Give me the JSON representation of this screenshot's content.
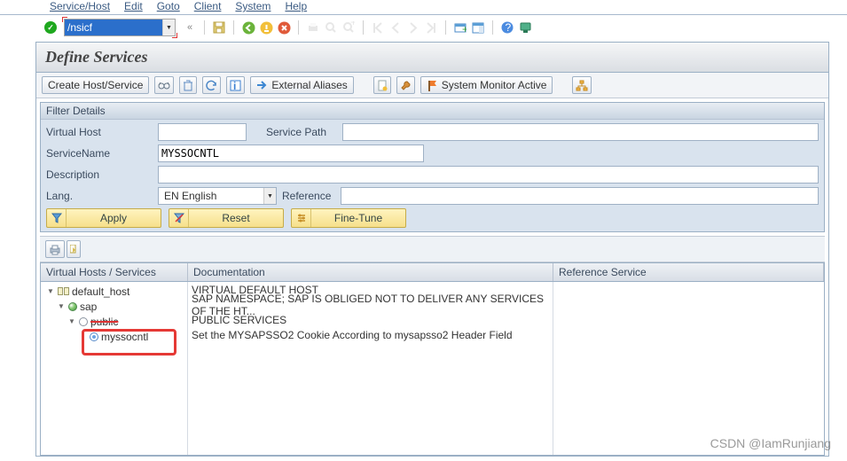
{
  "menu": {
    "m1": "Service/Host",
    "m2": "Edit",
    "m3": "Goto",
    "m4": "Client",
    "m5": "System",
    "m6": "Help"
  },
  "cmd": {
    "value": "/nsicf"
  },
  "page_title": "Define Services",
  "apptb": {
    "create": "Create Host/Service",
    "extal": "External Aliases",
    "sysmon": "System Monitor Active"
  },
  "filter": {
    "panel_title": "Filter Details",
    "vh_label": "Virtual Host",
    "vh_value": "",
    "sp_label": "Service Path",
    "sp_value": "",
    "sn_label": "ServiceName",
    "sn_value": "MYSSOCNTL",
    "desc_label": "Description",
    "desc_value": "",
    "lang_label": "Lang.",
    "lang_value": "EN English",
    "ref_label": "Reference",
    "ref_value": "",
    "apply": "Apply",
    "reset": "Reset",
    "fine": "Fine-Tune"
  },
  "grid": {
    "h1": "Virtual Hosts / Services",
    "h2": "Documentation",
    "h3": "Reference Service",
    "r1": {
      "name": "default_host",
      "doc": "VIRTUAL DEFAULT HOST"
    },
    "r2": {
      "name": "sap",
      "doc": "SAP NAMESPACE; SAP IS OBLIGED NOT TO DELIVER ANY SERVICES OF THE HT..."
    },
    "r3": {
      "name": "public",
      "doc": "PUBLIC SERVICES"
    },
    "r4": {
      "name": "myssocntl",
      "doc": "Set the MYSAPSSO2 Cookie According to mysapsso2 Header Field"
    }
  },
  "watermark": "CSDN @IamRunjiang"
}
